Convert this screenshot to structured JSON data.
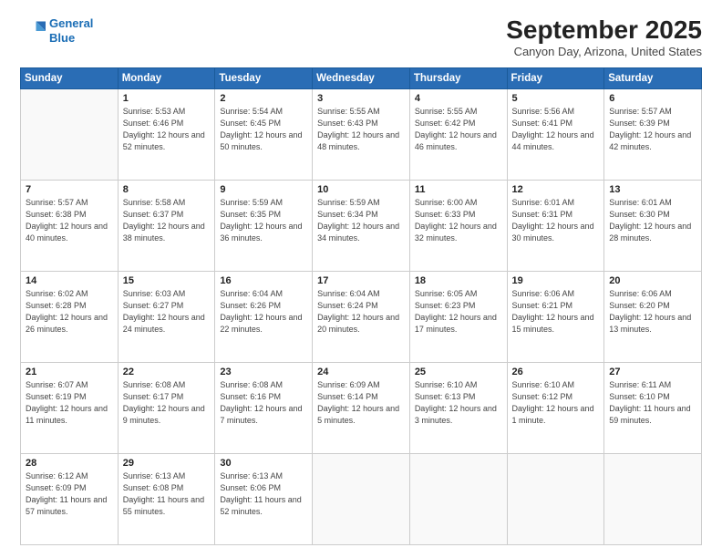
{
  "logo": {
    "line1": "General",
    "line2": "Blue"
  },
  "title": "September 2025",
  "subtitle": "Canyon Day, Arizona, United States",
  "header_days": [
    "Sunday",
    "Monday",
    "Tuesday",
    "Wednesday",
    "Thursday",
    "Friday",
    "Saturday"
  ],
  "weeks": [
    [
      {
        "day": "",
        "sunrise": "",
        "sunset": "",
        "daylight": ""
      },
      {
        "day": "1",
        "sunrise": "Sunrise: 5:53 AM",
        "sunset": "Sunset: 6:46 PM",
        "daylight": "Daylight: 12 hours and 52 minutes."
      },
      {
        "day": "2",
        "sunrise": "Sunrise: 5:54 AM",
        "sunset": "Sunset: 6:45 PM",
        "daylight": "Daylight: 12 hours and 50 minutes."
      },
      {
        "day": "3",
        "sunrise": "Sunrise: 5:55 AM",
        "sunset": "Sunset: 6:43 PM",
        "daylight": "Daylight: 12 hours and 48 minutes."
      },
      {
        "day": "4",
        "sunrise": "Sunrise: 5:55 AM",
        "sunset": "Sunset: 6:42 PM",
        "daylight": "Daylight: 12 hours and 46 minutes."
      },
      {
        "day": "5",
        "sunrise": "Sunrise: 5:56 AM",
        "sunset": "Sunset: 6:41 PM",
        "daylight": "Daylight: 12 hours and 44 minutes."
      },
      {
        "day": "6",
        "sunrise": "Sunrise: 5:57 AM",
        "sunset": "Sunset: 6:39 PM",
        "daylight": "Daylight: 12 hours and 42 minutes."
      }
    ],
    [
      {
        "day": "7",
        "sunrise": "Sunrise: 5:57 AM",
        "sunset": "Sunset: 6:38 PM",
        "daylight": "Daylight: 12 hours and 40 minutes."
      },
      {
        "day": "8",
        "sunrise": "Sunrise: 5:58 AM",
        "sunset": "Sunset: 6:37 PM",
        "daylight": "Daylight: 12 hours and 38 minutes."
      },
      {
        "day": "9",
        "sunrise": "Sunrise: 5:59 AM",
        "sunset": "Sunset: 6:35 PM",
        "daylight": "Daylight: 12 hours and 36 minutes."
      },
      {
        "day": "10",
        "sunrise": "Sunrise: 5:59 AM",
        "sunset": "Sunset: 6:34 PM",
        "daylight": "Daylight: 12 hours and 34 minutes."
      },
      {
        "day": "11",
        "sunrise": "Sunrise: 6:00 AM",
        "sunset": "Sunset: 6:33 PM",
        "daylight": "Daylight: 12 hours and 32 minutes."
      },
      {
        "day": "12",
        "sunrise": "Sunrise: 6:01 AM",
        "sunset": "Sunset: 6:31 PM",
        "daylight": "Daylight: 12 hours and 30 minutes."
      },
      {
        "day": "13",
        "sunrise": "Sunrise: 6:01 AM",
        "sunset": "Sunset: 6:30 PM",
        "daylight": "Daylight: 12 hours and 28 minutes."
      }
    ],
    [
      {
        "day": "14",
        "sunrise": "Sunrise: 6:02 AM",
        "sunset": "Sunset: 6:28 PM",
        "daylight": "Daylight: 12 hours and 26 minutes."
      },
      {
        "day": "15",
        "sunrise": "Sunrise: 6:03 AM",
        "sunset": "Sunset: 6:27 PM",
        "daylight": "Daylight: 12 hours and 24 minutes."
      },
      {
        "day": "16",
        "sunrise": "Sunrise: 6:04 AM",
        "sunset": "Sunset: 6:26 PM",
        "daylight": "Daylight: 12 hours and 22 minutes."
      },
      {
        "day": "17",
        "sunrise": "Sunrise: 6:04 AM",
        "sunset": "Sunset: 6:24 PM",
        "daylight": "Daylight: 12 hours and 20 minutes."
      },
      {
        "day": "18",
        "sunrise": "Sunrise: 6:05 AM",
        "sunset": "Sunset: 6:23 PM",
        "daylight": "Daylight: 12 hours and 17 minutes."
      },
      {
        "day": "19",
        "sunrise": "Sunrise: 6:06 AM",
        "sunset": "Sunset: 6:21 PM",
        "daylight": "Daylight: 12 hours and 15 minutes."
      },
      {
        "day": "20",
        "sunrise": "Sunrise: 6:06 AM",
        "sunset": "Sunset: 6:20 PM",
        "daylight": "Daylight: 12 hours and 13 minutes."
      }
    ],
    [
      {
        "day": "21",
        "sunrise": "Sunrise: 6:07 AM",
        "sunset": "Sunset: 6:19 PM",
        "daylight": "Daylight: 12 hours and 11 minutes."
      },
      {
        "day": "22",
        "sunrise": "Sunrise: 6:08 AM",
        "sunset": "Sunset: 6:17 PM",
        "daylight": "Daylight: 12 hours and 9 minutes."
      },
      {
        "day": "23",
        "sunrise": "Sunrise: 6:08 AM",
        "sunset": "Sunset: 6:16 PM",
        "daylight": "Daylight: 12 hours and 7 minutes."
      },
      {
        "day": "24",
        "sunrise": "Sunrise: 6:09 AM",
        "sunset": "Sunset: 6:14 PM",
        "daylight": "Daylight: 12 hours and 5 minutes."
      },
      {
        "day": "25",
        "sunrise": "Sunrise: 6:10 AM",
        "sunset": "Sunset: 6:13 PM",
        "daylight": "Daylight: 12 hours and 3 minutes."
      },
      {
        "day": "26",
        "sunrise": "Sunrise: 6:10 AM",
        "sunset": "Sunset: 6:12 PM",
        "daylight": "Daylight: 12 hours and 1 minute."
      },
      {
        "day": "27",
        "sunrise": "Sunrise: 6:11 AM",
        "sunset": "Sunset: 6:10 PM",
        "daylight": "Daylight: 11 hours and 59 minutes."
      }
    ],
    [
      {
        "day": "28",
        "sunrise": "Sunrise: 6:12 AM",
        "sunset": "Sunset: 6:09 PM",
        "daylight": "Daylight: 11 hours and 57 minutes."
      },
      {
        "day": "29",
        "sunrise": "Sunrise: 6:13 AM",
        "sunset": "Sunset: 6:08 PM",
        "daylight": "Daylight: 11 hours and 55 minutes."
      },
      {
        "day": "30",
        "sunrise": "Sunrise: 6:13 AM",
        "sunset": "Sunset: 6:06 PM",
        "daylight": "Daylight: 11 hours and 52 minutes."
      },
      {
        "day": "",
        "sunrise": "",
        "sunset": "",
        "daylight": ""
      },
      {
        "day": "",
        "sunrise": "",
        "sunset": "",
        "daylight": ""
      },
      {
        "day": "",
        "sunrise": "",
        "sunset": "",
        "daylight": ""
      },
      {
        "day": "",
        "sunrise": "",
        "sunset": "",
        "daylight": ""
      }
    ]
  ]
}
